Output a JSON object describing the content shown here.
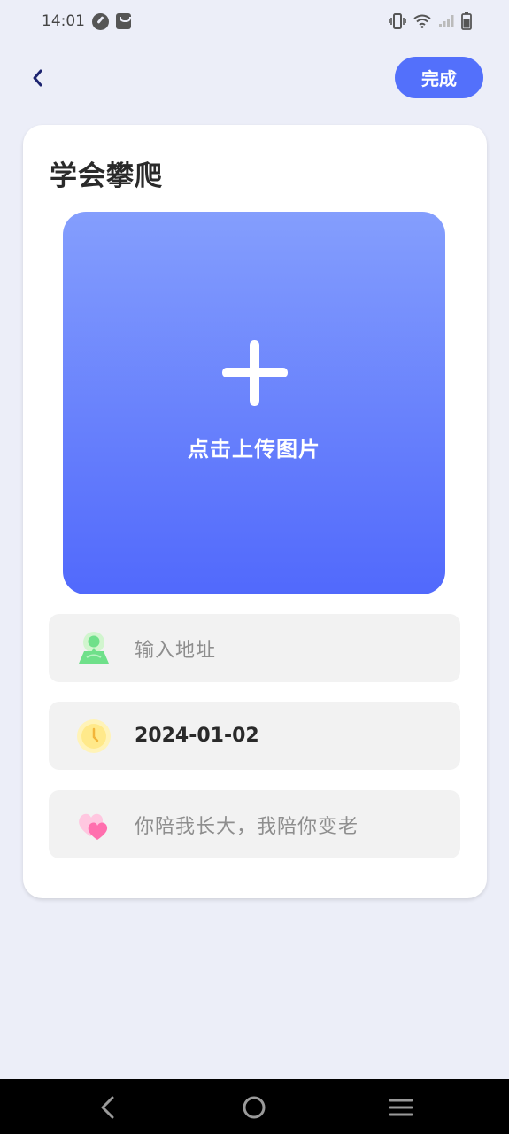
{
  "status_bar": {
    "time": "14:01"
  },
  "header": {
    "back_icon": "chevron-left-icon",
    "done_label": "完成"
  },
  "card": {
    "title": "学会攀爬",
    "upload": {
      "icon": "plus-icon",
      "label": "点击上传图片"
    },
    "fields": [
      {
        "icon": "location-person-icon",
        "value": "",
        "placeholder": "输入地址"
      },
      {
        "icon": "clock-icon",
        "value": "2024-01-02",
        "placeholder": ""
      },
      {
        "icon": "heart-icon",
        "value": "",
        "placeholder": "你陪我长大，我陪你变老"
      }
    ]
  },
  "colors": {
    "accent": "#5370fb",
    "background": "#eceef8",
    "upload_gradient_top": "#849efd",
    "upload_gradient_bottom": "#5169fc",
    "field_background": "#f2f2f2"
  },
  "nav_bar": {
    "icons": [
      "nav-back-icon",
      "nav-home-icon",
      "nav-menu-icon"
    ]
  }
}
